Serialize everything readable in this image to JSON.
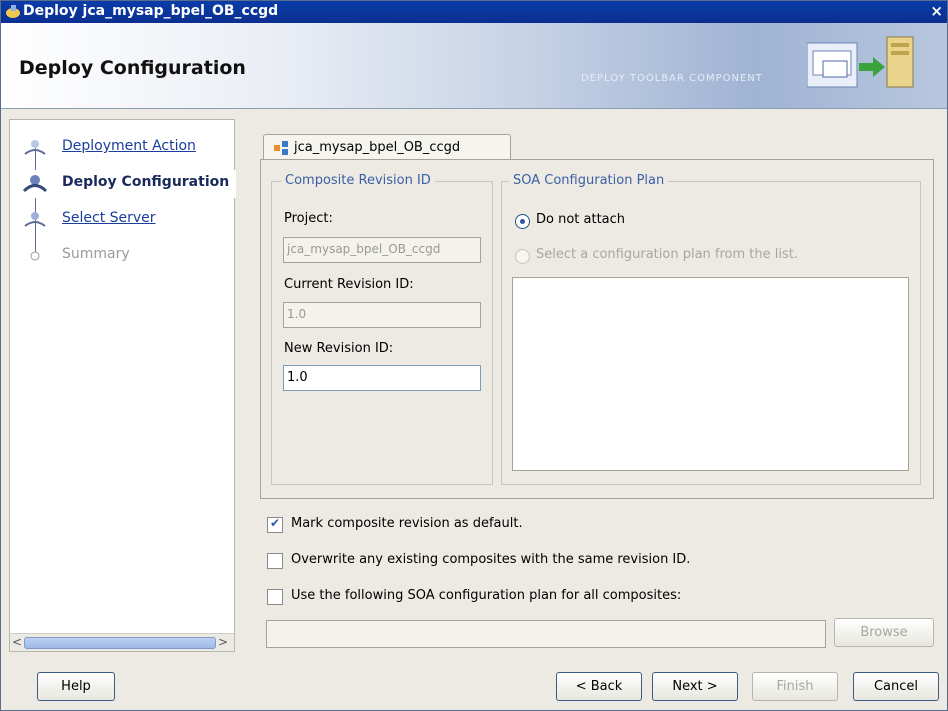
{
  "window": {
    "title": "Deploy jca_mysap_bpel_OB_ccgd",
    "close_glyph": "×"
  },
  "header": {
    "heading": "Deploy Configuration",
    "decoration": "DEPLOY TOOLBAR COMPONENT"
  },
  "nav": {
    "steps": [
      {
        "label": "Deployment Action",
        "state": "link"
      },
      {
        "label": "Deploy Configuration",
        "state": "current"
      },
      {
        "label": "Select Server",
        "state": "link"
      },
      {
        "label": "Summary",
        "state": "disabled"
      }
    ]
  },
  "tab": {
    "label": "jca_mysap_bpel_OB_ccgd"
  },
  "revision": {
    "legend": "Composite Revision ID",
    "project_label": "Project:",
    "project_value": "jca_mysap_bpel_OB_ccgd",
    "current_label": "Current Revision ID:",
    "current_value": "1.0",
    "new_label": "New Revision ID:",
    "new_value": "1.0"
  },
  "plan": {
    "legend": "SOA Configuration Plan",
    "option_not_attach": "Do not attach",
    "option_select": "Select a configuration plan from the list."
  },
  "options": {
    "mark_default": "Mark composite revision as default.",
    "overwrite": "Overwrite any existing composites with the same revision ID.",
    "use_plan": "Use the following SOA configuration plan for all composites:"
  },
  "browse_label": "Browse",
  "buttons": {
    "help": "Help",
    "back": "< Back",
    "next": "Next >",
    "finish": "Finish",
    "cancel": "Cancel"
  },
  "icons": {
    "app": "deploy-app-icon",
    "banner": "deploy-server-icon",
    "tab": "composite-icon",
    "step": "step-person-icon"
  }
}
